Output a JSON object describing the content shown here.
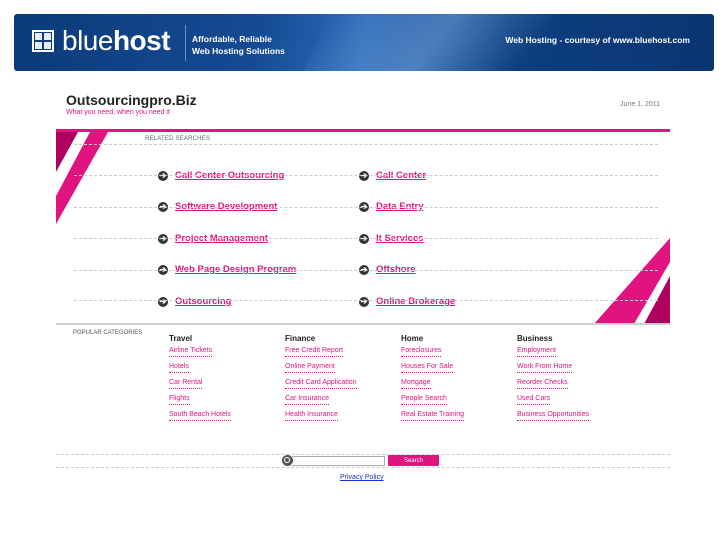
{
  "banner": {
    "logo_light": "blue",
    "logo_bold": "host",
    "tagline_line1": "Affordable, Reliable",
    "tagline_line2": "Web Hosting Solutions",
    "courtesy": "Web Hosting - courtesy of www.bluehost.com"
  },
  "header": {
    "title": "Outsourcingpro.Biz",
    "subtitle": "What you need, when you need it",
    "date": "June 1, 2011"
  },
  "related": {
    "label": "RELATED SEARCHES",
    "rows": [
      [
        "Call Center Outsourcing",
        "Call Center"
      ],
      [
        "Software Development",
        "Data Entry"
      ],
      [
        "Project Management",
        "It Services"
      ],
      [
        "Web Page Design Program",
        "Offshore"
      ],
      [
        "Outsourcing",
        "Online Brokerage"
      ]
    ]
  },
  "popular": {
    "label": "POPULAR CATEGORIES",
    "columns": [
      {
        "title": "Travel",
        "links": [
          "Airline Tickets",
          "Hotels",
          "Car Rental",
          "Flights",
          "South Beach Hotels"
        ]
      },
      {
        "title": "Finance",
        "links": [
          "Free Credit Report",
          "Online Payment",
          "Credit Card Application",
          "Car Insurance",
          "Health Insurance"
        ]
      },
      {
        "title": "Home",
        "links": [
          "Foreclosures",
          "Houses For Sale",
          "Mortgage",
          "People Search",
          "Real Estate Training"
        ]
      },
      {
        "title": "Business",
        "links": [
          "Employment",
          "Work From Home",
          "Reorder Checks",
          "Used Cars",
          "Business Opportunities"
        ]
      }
    ]
  },
  "footer": {
    "search_placeholder": "",
    "search_button": "Search",
    "privacy": "Privacy Policy"
  },
  "colors": {
    "accent": "#e0137f",
    "banner": "#0b3a78"
  },
  "icons": {
    "arrow": "arrow-right-circle-icon",
    "search": "search-icon",
    "logo": "bluehost-grid-icon"
  }
}
